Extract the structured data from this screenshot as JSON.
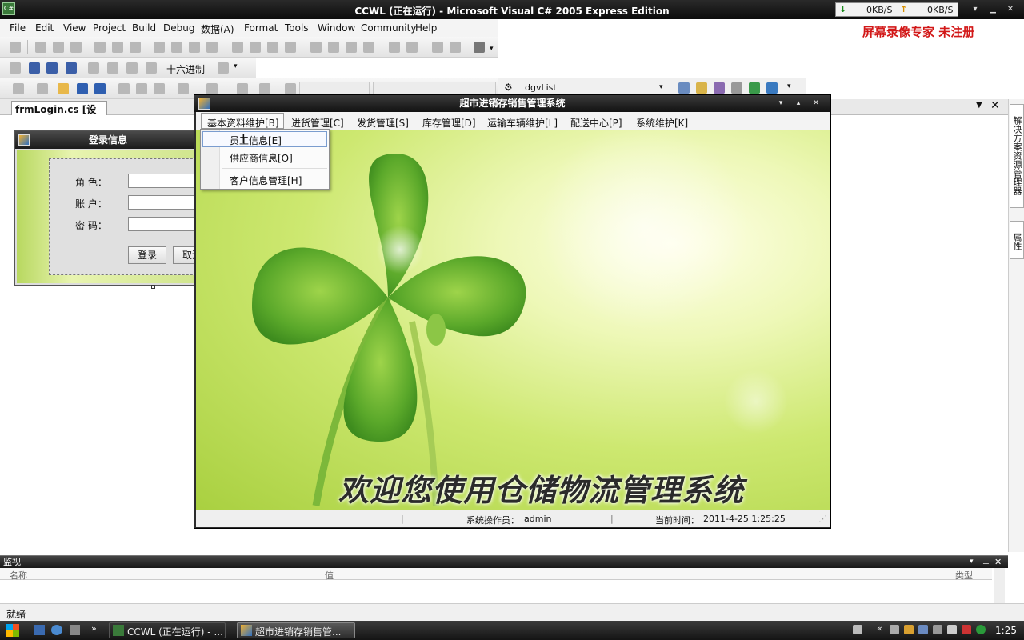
{
  "vs": {
    "title": "CCWL (正在运行) - Microsoft Visual C# 2005 Express Edition",
    "app_icon_text": "C#",
    "net": {
      "down_label": "0KB/S",
      "up_label": "0KB/S"
    },
    "menus": [
      "File",
      "Edit",
      "View",
      "Project",
      "Build",
      "Debug",
      "数据(A)",
      "Format",
      "Tools",
      "Window",
      "Community",
      "Help"
    ],
    "watermark": "屏幕录像专家  未注册",
    "debug_toolbar_text": "十六进制",
    "object_combo": "dgvList",
    "doc_tab": "frmLogin.cs [设计]",
    "right_tabs": [
      "解决方案资源管理器",
      "属性"
    ],
    "status_text": "就绪"
  },
  "login_form": {
    "title": "登录信息",
    "role_label": "角  色：",
    "account_label": "账  户：",
    "password_label": "密  码：",
    "login_button": "登录",
    "cancel_button": "取消"
  },
  "main_window": {
    "title": "超市进销存销售管理系统",
    "menus": [
      "基本资料维护[B]",
      "进货管理[C]",
      "发货管理[S]",
      "库存管理[D]",
      "运输车辆维护[L]",
      "配送中心[P]",
      "系统维护[K]"
    ],
    "dropdown_items": [
      "员工信息[E]",
      "供应商信息[O]",
      "客户信息管理[H]"
    ],
    "welcome": "欢迎您使用仓储物流管理系统",
    "status": {
      "operator_label": "系统操作员：",
      "operator": "admin",
      "time_label": "当前时间：",
      "time": "2011-4-25 1:25:25"
    }
  },
  "watch": {
    "title": "监视",
    "columns": [
      "名称",
      "值",
      "类型"
    ]
  },
  "taskbar": {
    "tasks": [
      "CCWL (正在运行) - ...",
      "超市进销存销售管..."
    ],
    "clock": "1:25"
  }
}
